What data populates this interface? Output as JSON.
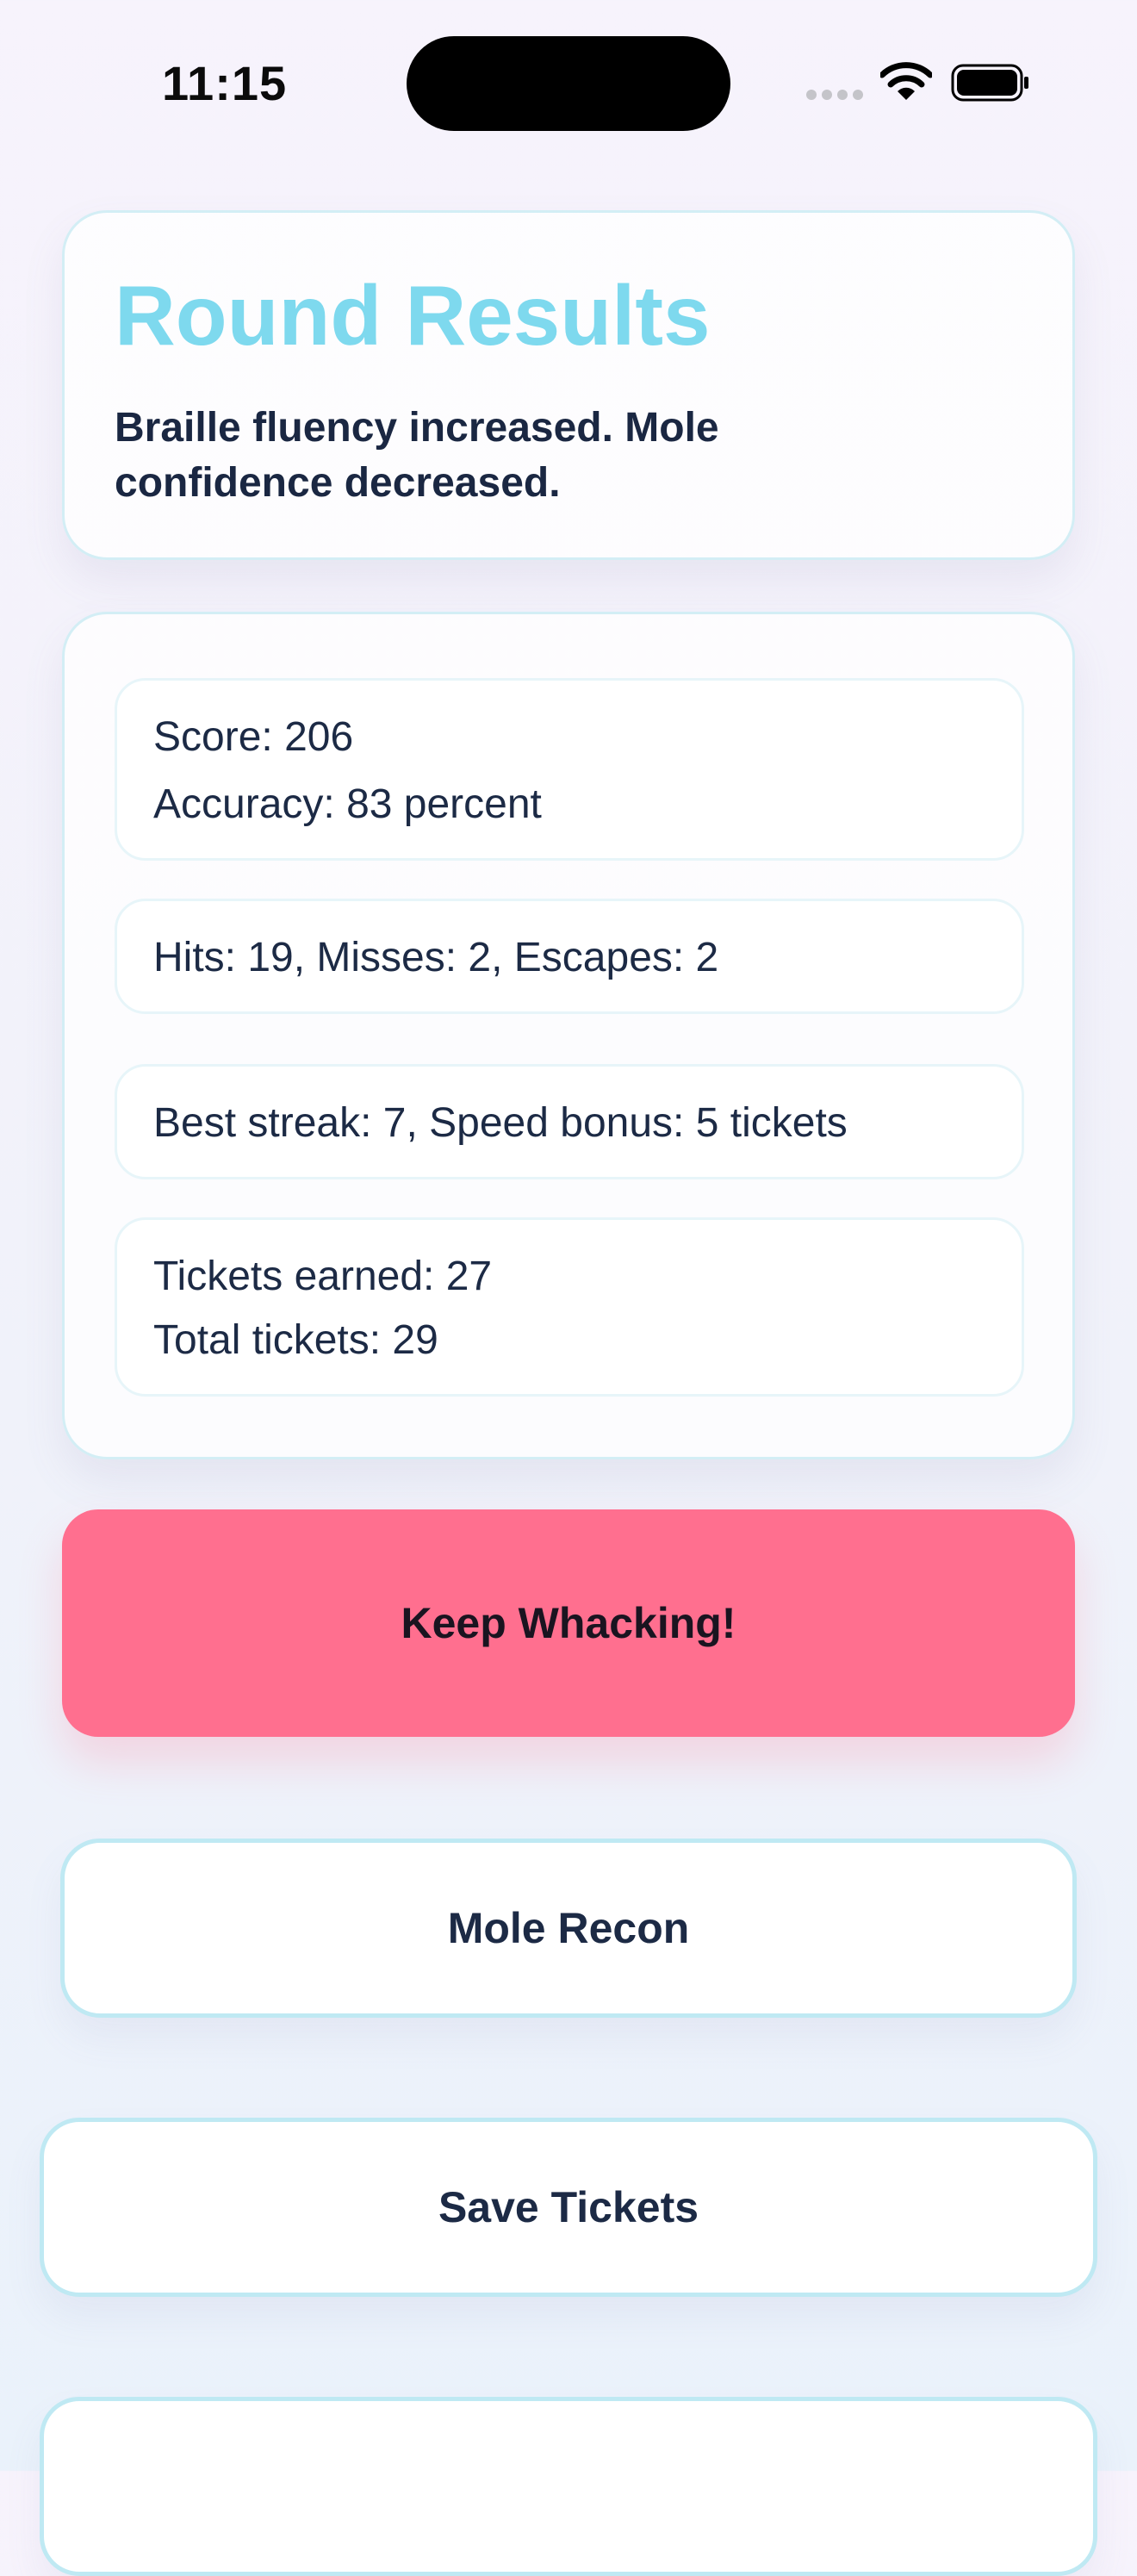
{
  "status_bar": {
    "time": "11:15"
  },
  "header": {
    "title": "Round Results",
    "subtitle": "Braille fluency increased. Mole confidence decreased."
  },
  "stats": {
    "rows": [
      {
        "lines": [
          "Score: 206",
          "Accuracy: 83 percent"
        ]
      },
      {
        "lines": [
          "Hits: 19, Misses: 2, Escapes: 2"
        ]
      },
      {
        "lines": [
          "Best streak: 7, Speed bonus: 5 tickets"
        ]
      },
      {
        "lines": [
          "Tickets earned: 27",
          "Total tickets: 29"
        ]
      }
    ]
  },
  "actions": {
    "primary_label": "Keep Whacking!",
    "recon_label": "Mole Recon",
    "save_label": "Save Tickets"
  },
  "colors": {
    "title_accent": "#7ed9ee",
    "primary_button": "#ff6f8f",
    "button_border": "#bfe9f3"
  },
  "icons": [
    "signal-icon",
    "wifi-icon",
    "battery-icon"
  ]
}
